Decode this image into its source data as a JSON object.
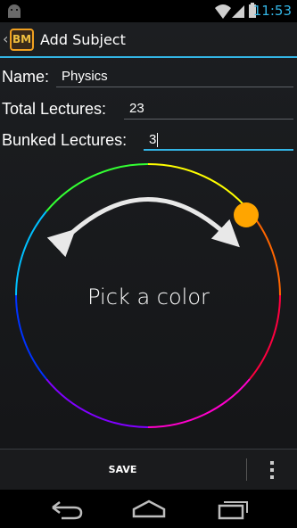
{
  "status_bar": {
    "time": "11:53",
    "icons": [
      "android-icon",
      "wifi-icon",
      "signal-icon",
      "battery-icon"
    ]
  },
  "action_bar": {
    "logo_text": "BM",
    "title": "Add Subject"
  },
  "form": {
    "name_label": "Name:",
    "name_value": "Physics",
    "total_label": "Total Lectures:",
    "total_value": "23",
    "bunked_label": "Bunked Lectures:",
    "bunked_value": "3"
  },
  "color_picker": {
    "label": "Pick a color",
    "selected_color": "#ffa500"
  },
  "bottom_bar": {
    "save_label": "SAVE"
  },
  "navigation": {
    "buttons": [
      "back-icon",
      "home-icon",
      "recents-icon"
    ]
  },
  "colors": {
    "accent": "#33b5e5",
    "selected": "#ffa500"
  }
}
